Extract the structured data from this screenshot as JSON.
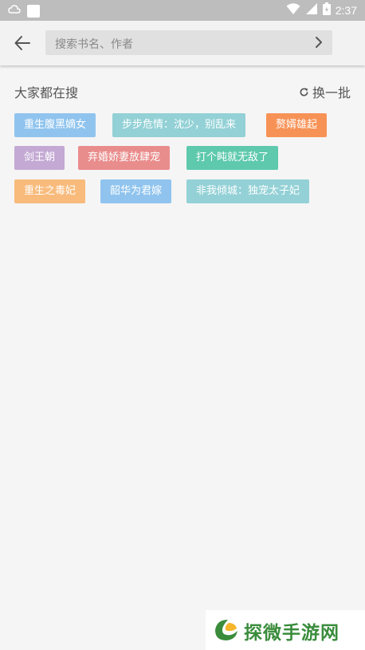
{
  "status_bar": {
    "time": "2:37"
  },
  "search": {
    "placeholder": "搜索书名、作者"
  },
  "section": {
    "title": "大家都在搜",
    "refresh_label": "换一批"
  },
  "tags": [
    {
      "label": "重生腹黑嫡女",
      "color": "#90c4ee"
    },
    {
      "label": "步步危情：沈少，别乱来",
      "color": "#93d1d6"
    },
    {
      "label": "赘婿雄起",
      "color": "#f79256"
    },
    {
      "label": "剑王朝",
      "color": "#c3a9d3"
    },
    {
      "label": "弃婚娇妻放肆宠",
      "color": "#e98c8c"
    },
    {
      "label": "打个盹就无敌了",
      "color": "#5ec9ad"
    },
    {
      "label": "重生之毒妃",
      "color": "#f8bb7c"
    },
    {
      "label": "韶华为君嫁",
      "color": "#90c4ee"
    },
    {
      "label": "非我倾城：独宠太子妃",
      "color": "#93d1d6"
    }
  ],
  "watermark": {
    "text": "探微手游网"
  }
}
